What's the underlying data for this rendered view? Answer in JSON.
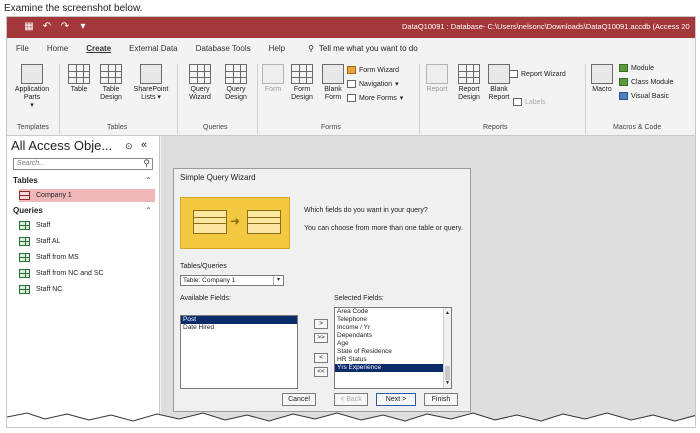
{
  "caption": "Examine the screenshot below.",
  "window": {
    "title": "DataQ10091 : Database- C:\\Users\\nelsonc\\Downloads\\DataQ10091.accdb (Access 20",
    "quick_access": [
      "save",
      "undo",
      "redo",
      "customize"
    ]
  },
  "ribbon_tabs": [
    "File",
    "Home",
    "Create",
    "External Data",
    "Database Tools",
    "Help"
  ],
  "active_tab": "Create",
  "tell_me": "Tell me what you want to do",
  "ribbon": {
    "templates": {
      "application_parts": "Application Parts",
      "label": "Templates"
    },
    "tables": {
      "table": "Table",
      "table_design": "Table Design",
      "sharepoint_lists": "SharePoint Lists",
      "label": "Tables"
    },
    "queries": {
      "query_wizard": "Query Wizard",
      "query_design": "Query Design",
      "label": "Queries"
    },
    "forms": {
      "form": "Form",
      "form_design": "Form Design",
      "blank_form": "Blank Form",
      "form_wizard": "Form Wizard",
      "navigation": "Navigation",
      "more_forms": "More Forms",
      "label": "Forms"
    },
    "reports": {
      "report": "Report",
      "report_design": "Report Design",
      "blank_report": "Blank Report",
      "labels": "Labels",
      "report_wizard": "Report Wizard",
      "label": "Reports"
    },
    "macros": {
      "macro": "Macro",
      "module": "Module",
      "class_module": "Class Module",
      "visual_basic": "Visual Basic",
      "label": "Macros & Code"
    }
  },
  "nav": {
    "title": "All Access Obje...",
    "search_placeholder": "Search...",
    "tables_header": "Tables",
    "tables": [
      "Company 1"
    ],
    "queries_header": "Queries",
    "queries": [
      "Staff",
      "Staff AL",
      "Staff from MS",
      "Staff from NC and SC",
      "Staff NC"
    ]
  },
  "wizard": {
    "title": "Simple Query Wizard",
    "question1": "Which fields do you want in your query?",
    "question2": "You can choose from more than one table or query.",
    "tables_label": "Tables/Queries",
    "table_value": "Table: Company 1",
    "available_label": "Available Fields:",
    "available_fields": [
      "Post",
      "Date Hired"
    ],
    "available_selected": 0,
    "selected_label": "Selected Fields:",
    "selected_fields": [
      "Area Code",
      "Telephone",
      "Income / Yr",
      "Dependants",
      "Age",
      "State of Residence",
      "HR Status",
      "Yrs Experience"
    ],
    "selected_selected": 7,
    "move_buttons": [
      ">",
      ">>",
      "<",
      "<<"
    ],
    "cancel": "Cancel",
    "back": "< Back",
    "next": "Next >",
    "finish": "Finish"
  }
}
